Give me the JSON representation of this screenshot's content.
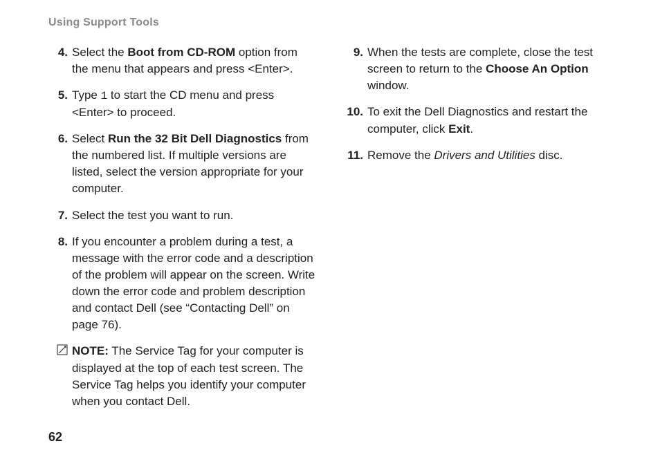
{
  "header": "Using Support Tools",
  "page_number": "62",
  "left": {
    "items": [
      {
        "num": "4.",
        "html": "Select the <b>Boot from CD-ROM</b> option from the menu that appears and press &lt;Enter&gt;."
      },
      {
        "num": "5.",
        "html": "Type <span class=\"mono\">1</span> to start the CD menu and press &lt;Enter&gt; to proceed."
      },
      {
        "num": "6.",
        "html": "Select <b>Run the 32 Bit Dell Diagnostics</b> from the numbered list. If multiple versions are listed, select the version appropriate for your&nbsp; computer."
      },
      {
        "num": "7.",
        "html": "Select the test you want to run."
      },
      {
        "num": "8.",
        "html": "If you encounter a problem during a test, a message with the error code and a description of the problem will appear on the screen. Write down the error code and problem description and contact Dell (see “Contacting Dell” on page 76)."
      }
    ],
    "note_html": "<b>NOTE:</b> The Service Tag for your computer is displayed at the top of each test screen. The Service Tag helps you identify your computer when you contact Dell."
  },
  "right": {
    "items": [
      {
        "num": "9.",
        "html": "When the tests are complete, close the test screen to return to the <b>Choose An Option</b> window."
      },
      {
        "num": "10.",
        "html": "To exit the Dell Diagnostics and restart the computer, click <b>Exit</b>."
      },
      {
        "num": "11.",
        "html": "Remove the <i>Drivers and Utilities</i> disc."
      }
    ]
  }
}
